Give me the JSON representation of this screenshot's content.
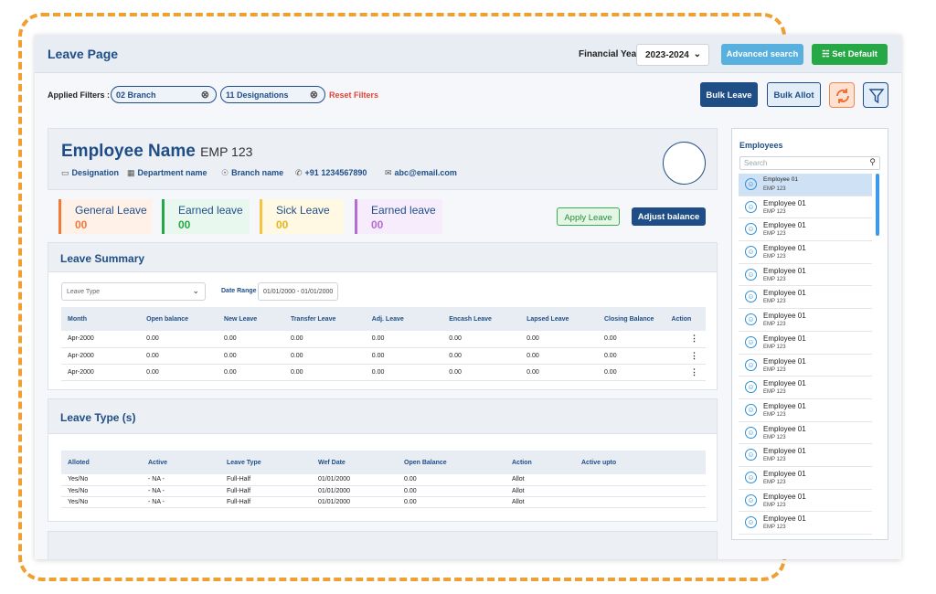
{
  "header": {
    "title": "Leave Page",
    "financial_year_label": "Financial Year",
    "financial_year_value": "2023-2024",
    "advanced_search": "Advanced search",
    "set_default": "Set Default"
  },
  "filters": {
    "label": "Applied Filters :",
    "chip1": "02 Branch",
    "chip2": "11 Designations",
    "reset": "Reset Filters"
  },
  "actions": {
    "bulk_leave": "Bulk Leave",
    "bulk_allot": "Bulk Allot"
  },
  "employee": {
    "name": "Employee Name",
    "code": "EMP 123",
    "designation": "Designation",
    "department": "Department name",
    "branch": "Branch name",
    "phone": "+91 1234567890",
    "email": "abc@email.com"
  },
  "leave_boxes": [
    {
      "title": "General Leave",
      "value": "00",
      "accent": "#f07a3a",
      "bg": "#fff0e8",
      "color": "#f07a3a"
    },
    {
      "title": "Earned leave",
      "value": "00",
      "accent": "#27a846",
      "bg": "#e8f8ee",
      "color": "#27a846"
    },
    {
      "title": "Sick Leave",
      "value": "00",
      "accent": "#f5c542",
      "bg": "#fff9e3",
      "color": "#e6b41f"
    },
    {
      "title": "Earned leave",
      "value": "00",
      "accent": "#b66cd6",
      "bg": "#f7ecfb",
      "color": "#b66cd6"
    }
  ],
  "apply_leave": "Apply Leave",
  "adjust_balance": "Adjust balance",
  "summary": {
    "title": "Leave Summary",
    "leave_type_placeholder": "Leave Type",
    "date_range_label": "Date Range",
    "date_range_value": "01/01/2000 - 01/01/2000",
    "columns": [
      "Month",
      "Open balance",
      "New Leave",
      "Transfer Leave",
      "Adj. Leave",
      "Encash Leave",
      "Lapsed Leave",
      "Closing Balance",
      "Action"
    ],
    "rows": [
      [
        "Apr-2000",
        "0.00",
        "0.00",
        "0.00",
        "0.00",
        "0.00",
        "0.00",
        "0.00"
      ],
      [
        "Apr-2000",
        "0.00",
        "0.00",
        "0.00",
        "0.00",
        "0.00",
        "0.00",
        "0.00"
      ],
      [
        "Apr-2000",
        "0.00",
        "0.00",
        "0.00",
        "0.00",
        "0.00",
        "0.00",
        "0.00"
      ]
    ]
  },
  "types": {
    "title": "Leave Type (s)",
    "columns": [
      "Alloted",
      "Active",
      "Leave Type",
      "Wef Date",
      "Open Balance",
      "Action",
      "Active upto"
    ],
    "rows": [
      [
        "Yes/No",
        "- NA -",
        "Full-Half",
        "01/01/2000",
        "0.00",
        "Allot",
        ""
      ],
      [
        "Yes/No",
        "- NA -",
        "Full-Half",
        "01/01/2000",
        "0.00",
        "Allot",
        ""
      ],
      [
        "Yes/No",
        "- NA -",
        "Full-Half",
        "01/01/2000",
        "0.00",
        "Allot",
        ""
      ]
    ]
  },
  "sidebar": {
    "title": "Employees",
    "search_placeholder": "Search",
    "employees": [
      {
        "name": "Employee 01",
        "code": "EMP 123"
      },
      {
        "name": "Employee 01",
        "code": "EMP 123"
      },
      {
        "name": "Employee 01",
        "code": "EMP 123"
      },
      {
        "name": "Employee 01",
        "code": "EMP 123"
      },
      {
        "name": "Employee 01",
        "code": "EMP 123"
      },
      {
        "name": "Employee 01",
        "code": "EMP 123"
      },
      {
        "name": "Employee 01",
        "code": "EMP 123"
      },
      {
        "name": "Employee 01",
        "code": "EMP 123"
      },
      {
        "name": "Employee 01",
        "code": "EMP 123"
      },
      {
        "name": "Employee 01",
        "code": "EMP 123"
      },
      {
        "name": "Employee 01",
        "code": "EMP 123"
      },
      {
        "name": "Employee 01",
        "code": "EMP 123"
      },
      {
        "name": "Employee 01",
        "code": "EMP 123"
      },
      {
        "name": "Employee 01",
        "code": "EMP 123"
      },
      {
        "name": "Employee 01",
        "code": "EMP 123"
      },
      {
        "name": "Employee 01",
        "code": "EMP 123"
      }
    ]
  }
}
